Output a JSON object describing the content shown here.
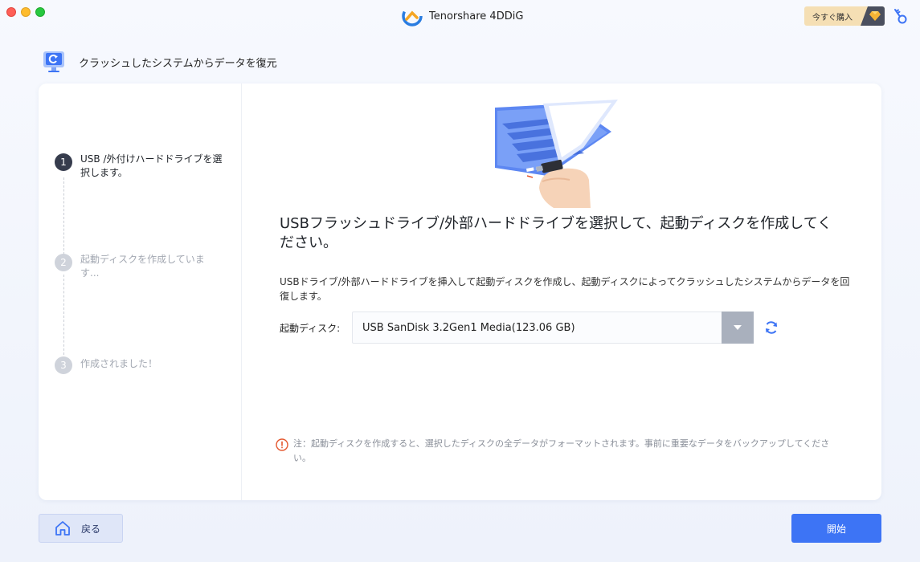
{
  "window": {
    "app_title": "Tenorshare 4DDiG",
    "buy_label": "今すぐ購入"
  },
  "header": {
    "title": "クラッシュしたシステムからデータを復元"
  },
  "steps": [
    {
      "num": "1",
      "label": "USB /外付けハードドライブを選択します。",
      "state": "active"
    },
    {
      "num": "2",
      "label": "起動ディスクを作成していま す...",
      "state": "inactive"
    },
    {
      "num": "3",
      "label": "作成されました！",
      "state": "inactive"
    }
  ],
  "main": {
    "title": "USBフラッシュドライブ/外部ハードドライブを選択して、起動ディスクを作成してください。",
    "description": "USBドライブ/外部ハードドライブを挿入して起動ディスクを作成し、起動ディスクによってクラッシュしたシステムからデータを回復します。",
    "disk_label": "起動ディスク:",
    "disk_value": "USB SanDisk 3.2Gen1 Media(123.06 GB)",
    "note": "注：起動ディスクを作成すると、選択したディスクの全データがフォーマットされます。事前に重要なデータをバックアップしてください。"
  },
  "footer": {
    "back_label": "戻る",
    "start_label": "開始"
  },
  "colors": {
    "accent": "#3d74f5",
    "step_active": "#363c4d",
    "warning": "#e4572e"
  },
  "icons": [
    "app-logo-icon",
    "gem-icon",
    "key-icon",
    "monitor-restore-icon",
    "chevron-down-icon",
    "refresh-icon",
    "warning-icon",
    "home-icon"
  ]
}
